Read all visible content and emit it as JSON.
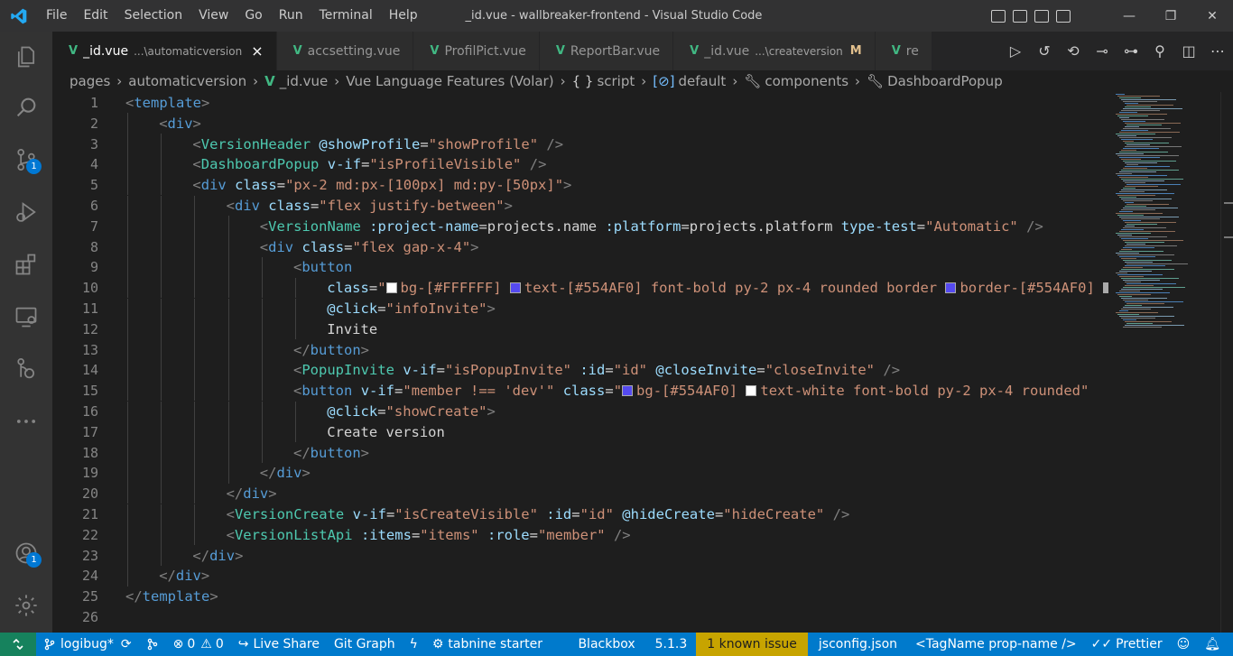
{
  "window": {
    "title": "_id.vue - wallbreaker-frontend - Visual Studio Code",
    "menu": [
      "File",
      "Edit",
      "Selection",
      "View",
      "Go",
      "Run",
      "Terminal",
      "Help"
    ]
  },
  "activity_bar": {
    "items": [
      {
        "name": "explorer-icon",
        "badge": ""
      },
      {
        "name": "search-icon",
        "badge": ""
      },
      {
        "name": "source-control-icon",
        "badge": "1"
      },
      {
        "name": "run-debug-icon",
        "badge": ""
      },
      {
        "name": "extensions-icon",
        "badge": ""
      },
      {
        "name": "remote-explorer-icon",
        "badge": ""
      },
      {
        "name": "git-graph-icon",
        "badge": ""
      },
      {
        "name": "more-icon",
        "badge": ""
      }
    ],
    "accounts_badge": "1"
  },
  "tabs": [
    {
      "label": "_id.vue",
      "description": "...\\automaticversion",
      "active": true,
      "modified": ""
    },
    {
      "label": "accsetting.vue",
      "description": "",
      "active": false,
      "modified": ""
    },
    {
      "label": "ProfilPict.vue",
      "description": "",
      "active": false,
      "modified": ""
    },
    {
      "label": "ReportBar.vue",
      "description": "",
      "active": false,
      "modified": ""
    },
    {
      "label": "_id.vue",
      "description": "...\\createversion",
      "active": false,
      "modified": "M"
    },
    {
      "label": "re",
      "description": "",
      "active": false,
      "modified": ""
    }
  ],
  "tab_icon_text": "V",
  "tab_close": "×",
  "breadcrumb": {
    "items": [
      "pages",
      "automaticversion",
      "_id.vue",
      "Vue Language Features (Volar)",
      "script",
      "default",
      "components",
      "DashboardPopup"
    ],
    "script_symbol": "{ }",
    "default_symbol": "[⊘]"
  },
  "editor": {
    "lines": [
      [
        [
          "pun",
          "<"
        ],
        [
          "tag",
          "template"
        ],
        [
          "pun",
          ">"
        ]
      ],
      [
        [
          "pun",
          "<"
        ],
        [
          "tag",
          "div"
        ],
        [
          "pun",
          ">"
        ]
      ],
      [
        [
          "pun",
          "<"
        ],
        [
          "comp",
          "VersionHeader"
        ],
        [
          "txt",
          " "
        ],
        [
          "attr",
          "@showProfile"
        ],
        [
          "txt",
          "="
        ],
        [
          "str",
          "\"showProfile\""
        ],
        [
          "txt",
          " "
        ],
        [
          "pun",
          "/>"
        ]
      ],
      [
        [
          "pun",
          "<"
        ],
        [
          "comp",
          "DashboardPopup"
        ],
        [
          "txt",
          " "
        ],
        [
          "attr",
          "v-if"
        ],
        [
          "txt",
          "="
        ],
        [
          "str",
          "\"isProfileVisible\""
        ],
        [
          "txt",
          " "
        ],
        [
          "pun",
          "/>"
        ]
      ],
      [
        [
          "pun",
          "<"
        ],
        [
          "tag",
          "div"
        ],
        [
          "txt",
          " "
        ],
        [
          "attr",
          "class"
        ],
        [
          "txt",
          "="
        ],
        [
          "str",
          "\"px-2 md:px-[100px] md:py-[50px]\""
        ],
        [
          "pun",
          ">"
        ]
      ],
      [
        [
          "pun",
          "<"
        ],
        [
          "tag",
          "div"
        ],
        [
          "txt",
          " "
        ],
        [
          "attr",
          "class"
        ],
        [
          "txt",
          "="
        ],
        [
          "str",
          "\"flex justify-between\""
        ],
        [
          "pun",
          ">"
        ]
      ],
      [
        [
          "pun",
          "<"
        ],
        [
          "comp",
          "VersionName"
        ],
        [
          "txt",
          " "
        ],
        [
          "attr",
          ":project-name"
        ],
        [
          "txt",
          "=projects.name "
        ],
        [
          "attr",
          ":platform"
        ],
        [
          "txt",
          "=projects.platform "
        ],
        [
          "attr",
          "type-test"
        ],
        [
          "txt",
          "="
        ],
        [
          "str",
          "\"Automatic\""
        ],
        [
          "txt",
          " "
        ],
        [
          "pun",
          "/>"
        ]
      ],
      [
        [
          "pun",
          "<"
        ],
        [
          "tag",
          "div"
        ],
        [
          "txt",
          " "
        ],
        [
          "attr",
          "class"
        ],
        [
          "txt",
          "="
        ],
        [
          "str",
          "\"flex gap-x-4\""
        ],
        [
          "pun",
          ">"
        ]
      ],
      [
        [
          "pun",
          "<"
        ],
        [
          "tag",
          "button"
        ]
      ],
      [
        [
          "attr",
          "class"
        ],
        [
          "txt",
          "="
        ],
        [
          "str",
          "\""
        ],
        [
          "sw#ffffff",
          ""
        ],
        [
          "str",
          "bg-[#FFFFFF] "
        ],
        [
          "sw#554af0",
          ""
        ],
        [
          "str",
          "text-[#554AF0] font-bold py-2 px-4 rounded border "
        ],
        [
          "sw#554af0",
          ""
        ],
        [
          "str",
          "border-[#554AF0] "
        ],
        [
          "sw#aaaaaa",
          ""
        ]
      ],
      [
        [
          "attr",
          "@click"
        ],
        [
          "txt",
          "="
        ],
        [
          "str",
          "\"infoInvite\""
        ],
        [
          "pun",
          ">"
        ]
      ],
      [
        [
          "txt",
          "Invite"
        ]
      ],
      [
        [
          "pun",
          "</"
        ],
        [
          "tag",
          "button"
        ],
        [
          "pun",
          ">"
        ]
      ],
      [
        [
          "pun",
          "<"
        ],
        [
          "comp",
          "PopupInvite"
        ],
        [
          "txt",
          " "
        ],
        [
          "attr",
          "v-if"
        ],
        [
          "txt",
          "="
        ],
        [
          "str",
          "\"isPopupInvite\""
        ],
        [
          "txt",
          " "
        ],
        [
          "attr",
          ":id"
        ],
        [
          "txt",
          "="
        ],
        [
          "str",
          "\"id\""
        ],
        [
          "txt",
          " "
        ],
        [
          "attr",
          "@closeInvite"
        ],
        [
          "txt",
          "="
        ],
        [
          "str",
          "\"closeInvite\""
        ],
        [
          "txt",
          " "
        ],
        [
          "pun",
          "/>"
        ]
      ],
      [
        [
          "pun",
          "<"
        ],
        [
          "tag",
          "button"
        ],
        [
          "txt",
          " "
        ],
        [
          "attr",
          "v-if"
        ],
        [
          "txt",
          "="
        ],
        [
          "str",
          "\"member !== 'dev'\""
        ],
        [
          "txt",
          " "
        ],
        [
          "attr",
          "class"
        ],
        [
          "txt",
          "="
        ],
        [
          "str",
          "\""
        ],
        [
          "sw#554af0",
          ""
        ],
        [
          "str",
          "bg-[#554AF0] "
        ],
        [
          "sw#ffffff",
          ""
        ],
        [
          "str",
          "text-white font-bold py-2 px-4 rounded\""
        ]
      ],
      [
        [
          "attr",
          "@click"
        ],
        [
          "txt",
          "="
        ],
        [
          "str",
          "\"showCreate\""
        ],
        [
          "pun",
          ">"
        ]
      ],
      [
        [
          "txt",
          "Create version"
        ]
      ],
      [
        [
          "pun",
          "</"
        ],
        [
          "tag",
          "button"
        ],
        [
          "pun",
          ">"
        ]
      ],
      [
        [
          "pun",
          "</"
        ],
        [
          "tag",
          "div"
        ],
        [
          "pun",
          ">"
        ]
      ],
      [
        [
          "pun",
          "</"
        ],
        [
          "tag",
          "div"
        ],
        [
          "pun",
          ">"
        ]
      ],
      [
        [
          "pun",
          "<"
        ],
        [
          "comp",
          "VersionCreate"
        ],
        [
          "txt",
          " "
        ],
        [
          "attr",
          "v-if"
        ],
        [
          "txt",
          "="
        ],
        [
          "str",
          "\"isCreateVisible\""
        ],
        [
          "txt",
          " "
        ],
        [
          "attr",
          ":id"
        ],
        [
          "txt",
          "="
        ],
        [
          "str",
          "\"id\""
        ],
        [
          "txt",
          " "
        ],
        [
          "attr",
          "@hideCreate"
        ],
        [
          "txt",
          "="
        ],
        [
          "str",
          "\"hideCreate\""
        ],
        [
          "txt",
          " "
        ],
        [
          "pun",
          "/>"
        ]
      ],
      [
        [
          "pun",
          "<"
        ],
        [
          "comp",
          "VersionListApi"
        ],
        [
          "txt",
          " "
        ],
        [
          "attr",
          ":items"
        ],
        [
          "txt",
          "="
        ],
        [
          "str",
          "\"items\""
        ],
        [
          "txt",
          " "
        ],
        [
          "attr",
          ":role"
        ],
        [
          "txt",
          "="
        ],
        [
          "str",
          "\"member\""
        ],
        [
          "txt",
          " "
        ],
        [
          "pun",
          "/>"
        ]
      ],
      [
        [
          "pun",
          "</"
        ],
        [
          "tag",
          "div"
        ],
        [
          "pun",
          ">"
        ]
      ],
      [
        [
          "pun",
          "</"
        ],
        [
          "tag",
          "div"
        ],
        [
          "pun",
          ">"
        ]
      ],
      [
        [
          "pun",
          "</"
        ],
        [
          "tag",
          "template"
        ],
        [
          "pun",
          ">"
        ]
      ],
      []
    ],
    "indents": [
      0,
      1,
      2,
      2,
      2,
      3,
      4,
      4,
      5,
      6,
      6,
      6,
      5,
      5,
      5,
      6,
      6,
      5,
      4,
      3,
      3,
      3,
      2,
      1,
      0,
      0
    ]
  },
  "statusbar": {
    "remote_icon": "remote-icon",
    "branch": "logibug*",
    "errors": "0",
    "warnings": "0",
    "live_share": "Live Share",
    "git_graph": "Git Graph",
    "tabnine": "tabnine starter",
    "blackbox": "Blackbox",
    "version": "5.1.3",
    "known_issue": "1 known issue",
    "jsconfig": "jsconfig.json",
    "tagname": "<TagName prop-name />",
    "prettier": "Prettier"
  },
  "colors": {
    "statusbar": "#007acc",
    "vue_green": "#41b883",
    "accent": "#0078d4"
  }
}
